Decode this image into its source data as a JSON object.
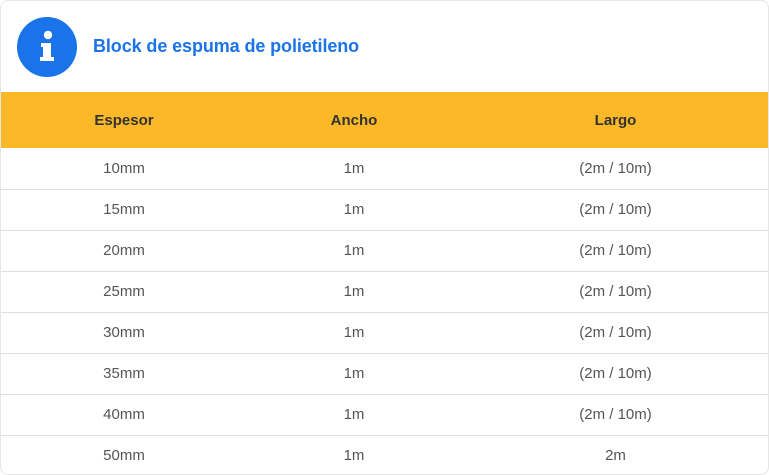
{
  "card": {
    "title": "Block de espuma de polietileno",
    "icon": "info-icon",
    "accent_color": "#1a73e8",
    "header_row_color": "#fbb829"
  },
  "table": {
    "columns": [
      "Espesor",
      "Ancho",
      "Largo"
    ],
    "rows": [
      [
        "10mm",
        "1m",
        "(2m / 10m)"
      ],
      [
        "15mm",
        "1m",
        "(2m / 10m)"
      ],
      [
        "20mm",
        "1m",
        "(2m / 10m)"
      ],
      [
        "25mm",
        "1m",
        "(2m / 10m)"
      ],
      [
        "30mm",
        "1m",
        "(2m / 10m)"
      ],
      [
        "35mm",
        "1m",
        "(2m / 10m)"
      ],
      [
        "40mm",
        "1m",
        "(2m / 10m)"
      ],
      [
        "50mm",
        "1m",
        "2m"
      ]
    ]
  }
}
